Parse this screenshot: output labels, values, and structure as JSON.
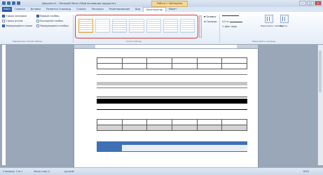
{
  "window": {
    "title": "Документ1 - Microsoft Word (Сбой активации продукта)",
    "context_tab": "Работа с таблицами"
  },
  "tabs": [
    "Главная",
    "Вставка",
    "Разметка страницы",
    "Ссылки",
    "Рассылки",
    "Рецензирование",
    "Вид",
    "Конструктор",
    "Макет"
  ],
  "file_tab": "Файл",
  "ribbon": {
    "options": [
      {
        "label": "Строка заголовка",
        "checked": true
      },
      {
        "label": "Строка итогов",
        "checked": false
      },
      {
        "label": "Чередующиеся строки",
        "checked": true
      },
      {
        "label": "Первый столбец",
        "checked": true
      },
      {
        "label": "Последний столбец",
        "checked": false
      },
      {
        "label": "Чередующиеся столбцы",
        "checked": false
      }
    ],
    "options_group_label": "Параметры стилей таблиц",
    "styles_group_label": "Стили таблиц",
    "shading_label": "Заливка",
    "borders_label": "Границы",
    "pen_weight": "0,5 пт",
    "pen_color_label": "Цвет пера",
    "draw_label": "Нарисовать таблицу",
    "eraser_label": "Ластик",
    "borders_group_label": "Нарисовать границы"
  },
  "statusbar": {
    "page": "Страница: 1 из 1",
    "words": "Число слов: 0",
    "lang": "русский",
    "zoom": "100%"
  },
  "colors": {
    "highlight_border": "#d93b35",
    "ribbon_bg": "#e3ecf7",
    "file_tab": "#2a5da8",
    "table_accent": "#3f70b5"
  }
}
